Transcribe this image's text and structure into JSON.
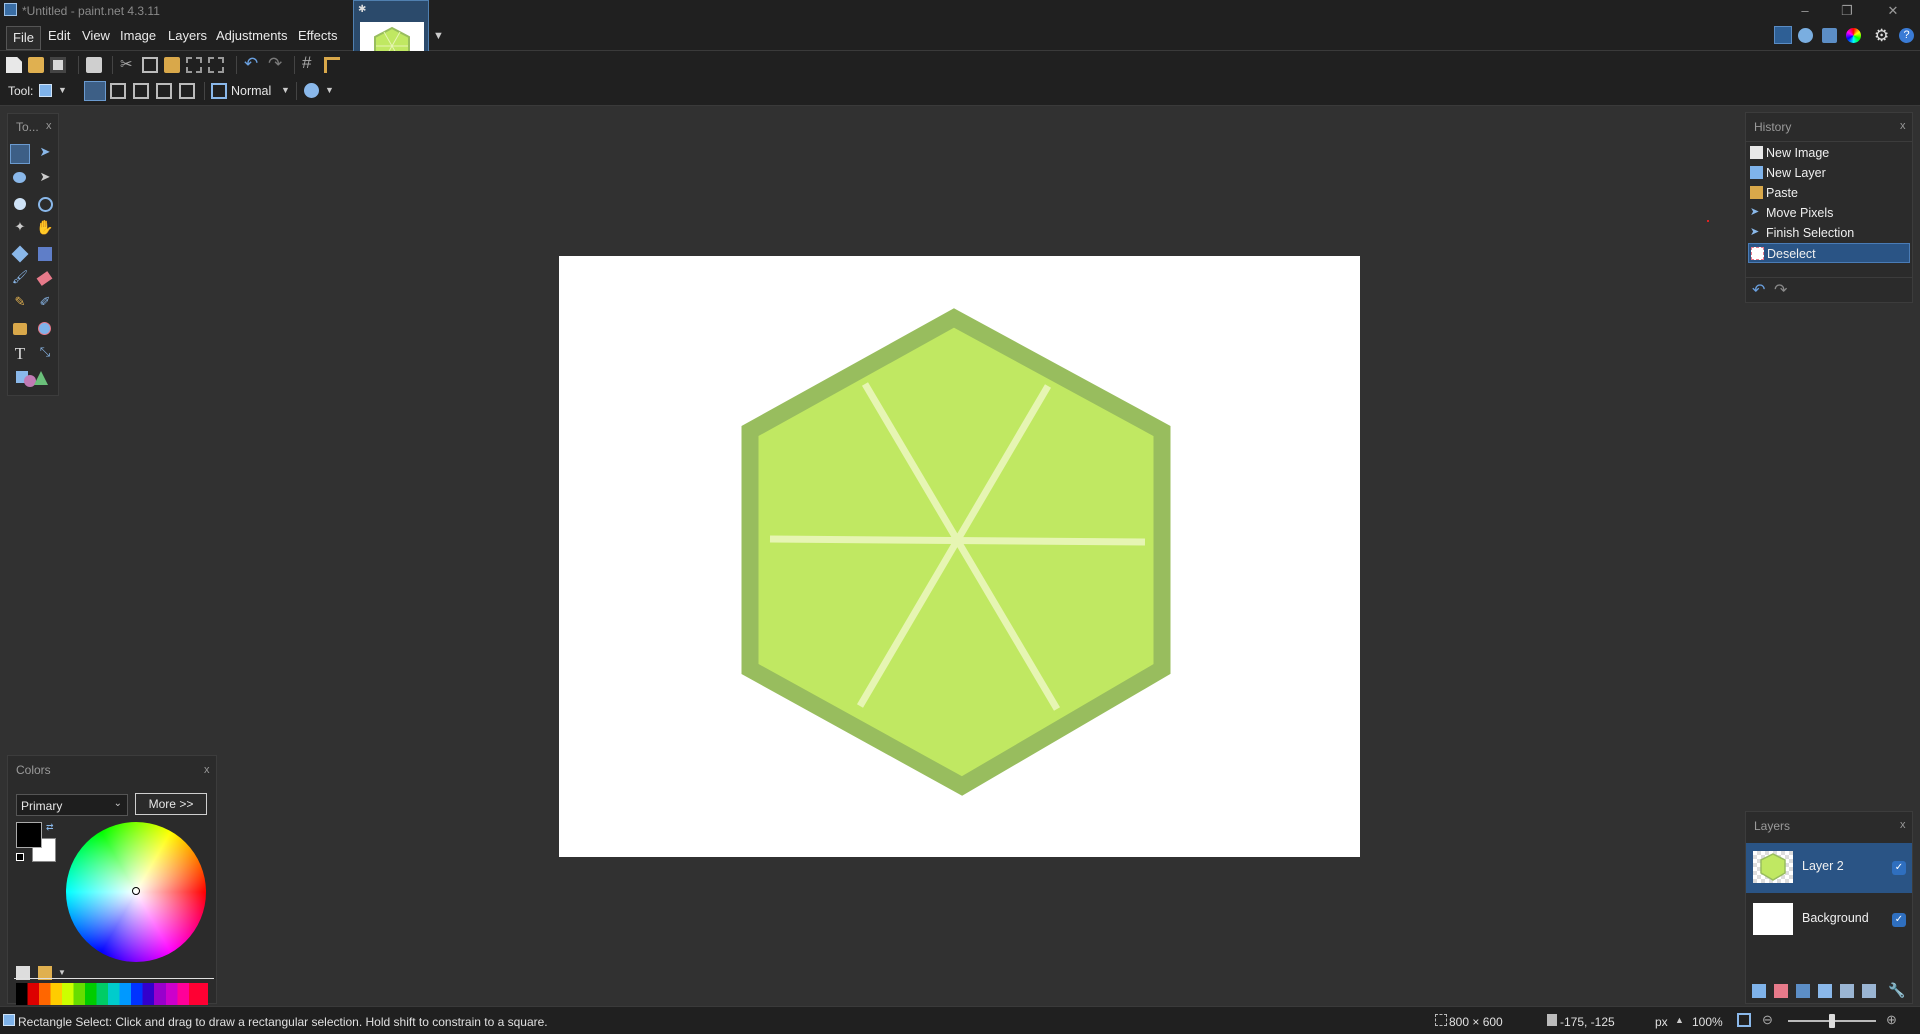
{
  "window": {
    "title": "*Untitled - paint.net 4.3.11",
    "controls": [
      "–",
      "❐",
      "✕"
    ]
  },
  "menu": [
    "File",
    "Edit",
    "View",
    "Image",
    "Layers",
    "Adjustments",
    "Effects"
  ],
  "toolbar": {
    "tool_label": "Tool:",
    "blend_mode": "Normal"
  },
  "tools_panel": {
    "title": "To...",
    "close": "x"
  },
  "history": {
    "title": "History",
    "close": "x",
    "items": [
      "New Image",
      "New Layer",
      "Paste",
      "Move Pixels",
      "Finish Selection",
      "Deselect"
    ],
    "selected_index": 5
  },
  "layers": {
    "title": "Layers",
    "close": "x",
    "items": [
      {
        "name": "Layer 2",
        "visible": true,
        "selected": true
      },
      {
        "name": "Background",
        "visible": true,
        "selected": false
      }
    ]
  },
  "colors": {
    "title": "Colors",
    "close": "x",
    "dropdown_value": "Primary",
    "more_label": "More >>",
    "primary": "#000000",
    "secondary": "#ffffff"
  },
  "canvas": {
    "shape_fill": "#c0e862",
    "shape_border": "#98bd5e",
    "segment_lines": "#e6f5b3"
  },
  "status": {
    "hint": "Rectangle Select: Click and drag to draw a rectangular selection. Hold shift to constrain to a square.",
    "image_size": "800 × 600",
    "cursor_pos": "-175, -125",
    "units": "px",
    "zoom": "100%"
  }
}
